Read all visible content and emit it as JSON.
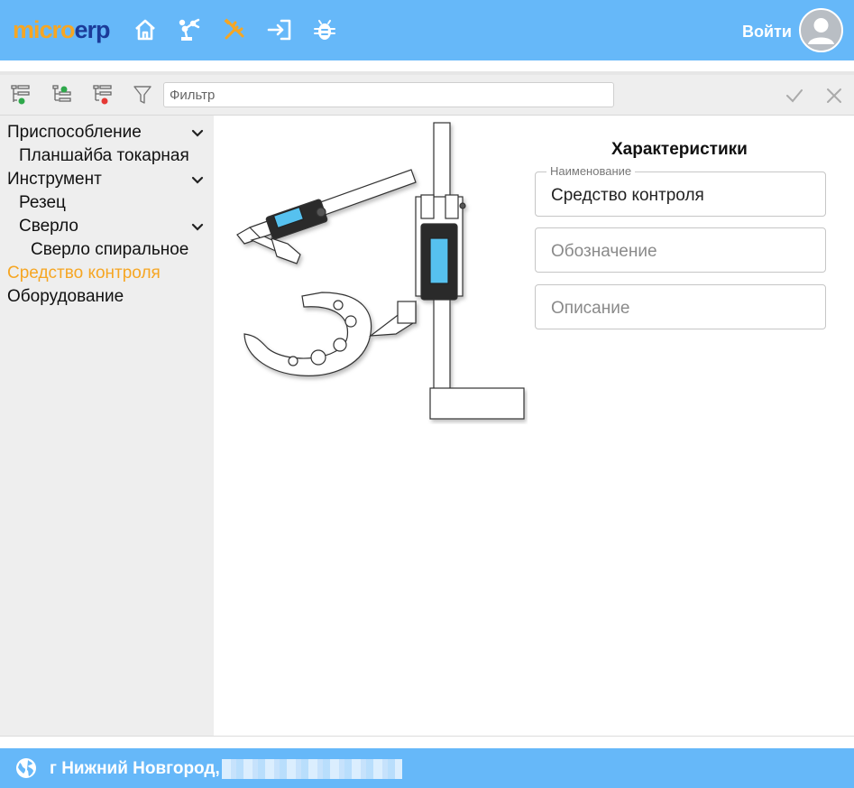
{
  "header": {
    "logo_micro": "micro",
    "logo_erp": "erp",
    "login_label": "Войти",
    "nav_icons": [
      "home-icon",
      "robot-arm-icon",
      "tools-icon",
      "sign-in-icon",
      "bug-icon"
    ],
    "colors": {
      "header_bg": "#66b8f9",
      "accent": "#f6a623",
      "logo_dark": "#1b3b99"
    }
  },
  "toolbar": {
    "filter_placeholder": "Фильтр",
    "icons": [
      "tree-expand-icon",
      "tree-add-icon",
      "tree-remove-icon",
      "filter-icon"
    ],
    "right_icons": [
      "check-icon",
      "close-icon"
    ]
  },
  "sidebar": {
    "items": [
      {
        "label": "Приспособление",
        "expandable": true
      },
      {
        "label": "Планшайба токарная",
        "expandable": false
      },
      {
        "label": "Инструмент",
        "expandable": true
      },
      {
        "label": "Резец",
        "expandable": false
      },
      {
        "label": "Сверло",
        "expandable": true
      },
      {
        "label": "Сверло спиральное",
        "expandable": false
      },
      {
        "label": "Средство контроля",
        "expandable": false,
        "active": true
      },
      {
        "label": "Оборудование",
        "expandable": false
      }
    ]
  },
  "main": {
    "panel_title": "Характеристики",
    "fields": {
      "name": {
        "label": "Наименование",
        "value": "Средство контроля"
      },
      "designation": {
        "placeholder": "Обозначение"
      },
      "description": {
        "placeholder": "Описание"
      }
    }
  },
  "footer": {
    "location_text": "г Нижний Новгород,",
    "icon": "globe-icon"
  }
}
